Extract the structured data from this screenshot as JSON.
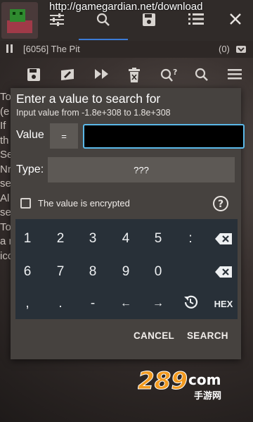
{
  "top_bar": {
    "url": "http://gamegardian.net/download",
    "process": "[6056] The Pit",
    "count": "(0)"
  },
  "background_text": "To\n(e\nIf\nth\nSe\nNr\nse\nAl\nse\nTo\na r\nicc",
  "dialog": {
    "title": "Enter a value to search for",
    "subtitle": "Input value from -1.8e+308 to 1.8e+308",
    "value_label": "Value",
    "eq_button": "=",
    "value_input": "",
    "type_label": "Type:",
    "type_value": "???",
    "encrypted_label": "The value is encrypted",
    "cancel": "CANCEL",
    "search": "SEARCH"
  },
  "keyboard": {
    "row1": [
      "1",
      "2",
      "3",
      "4",
      "5",
      ":"
    ],
    "row2": [
      "6",
      "7",
      "8",
      "9",
      "0"
    ],
    "row3": [
      ",",
      ".",
      "-",
      "←",
      "→"
    ],
    "hex": "HEX"
  },
  "watermark": {
    "brand": "289",
    "suffix": "com",
    "sub": "手游网"
  },
  "colors": {
    "accent": "#5bb8e8",
    "tab_underline": "#3b7bd6",
    "dialog_bg": "#46423f",
    "keyboard_bg": "#283038",
    "watermark_orange": "#f29a1f"
  },
  "icons": [
    "settings-sliders-icon",
    "search-icon",
    "save-icon",
    "list-icon",
    "close-icon",
    "pause-icon",
    "delete-icon",
    "search-unknown-icon",
    "menu-icon",
    "backspace-icon",
    "history-icon",
    "help-icon"
  ]
}
